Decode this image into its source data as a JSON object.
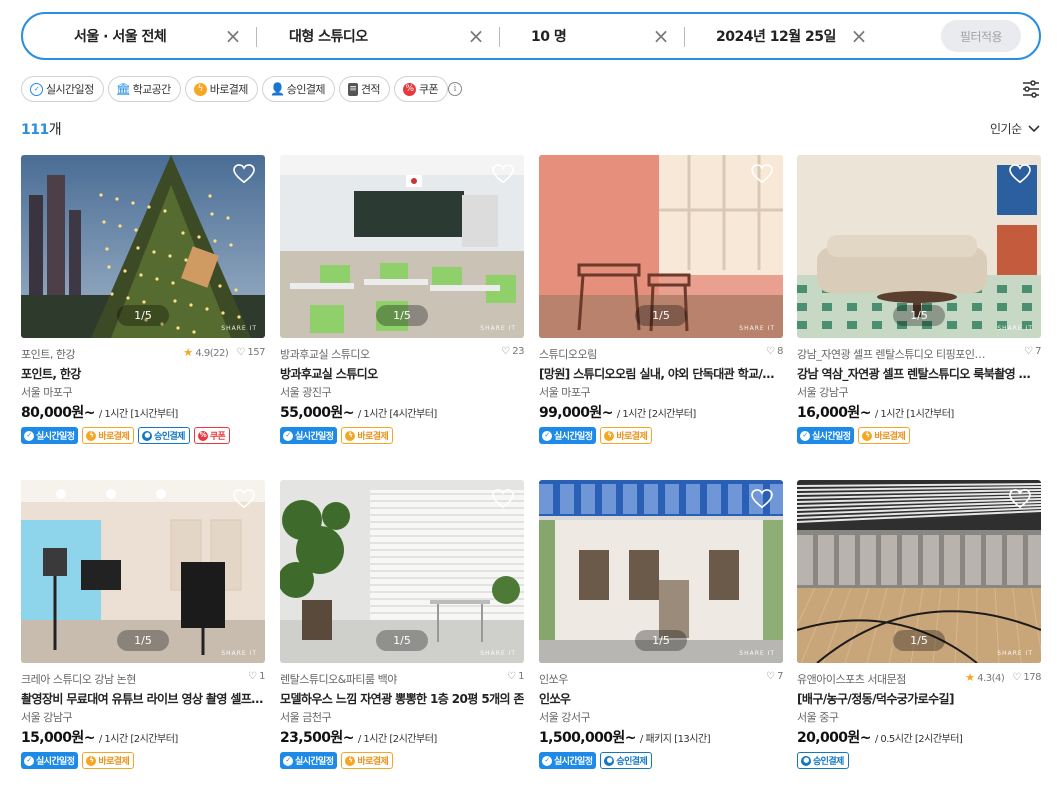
{
  "search": {
    "location": "서울 · 서울 전체",
    "space_type": "대형 스튜디오",
    "guests": "10 명",
    "date": "2024년 12월 25일",
    "apply_label": "필터적용"
  },
  "filters": [
    {
      "label": "실시간일정",
      "icon": "clock-check-icon"
    },
    {
      "label": "학교공간",
      "icon": "school-icon"
    },
    {
      "label": "바로결제",
      "icon": "lightning-icon"
    },
    {
      "label": "승인결제",
      "icon": "person-icon"
    },
    {
      "label": "견적",
      "icon": "document-icon"
    },
    {
      "label": "쿠폰",
      "icon": "coupon-icon"
    }
  ],
  "results": {
    "count": "111",
    "unit": "개",
    "sort_label": "인기순"
  },
  "colors": {
    "accent": "#2a8fe0",
    "realtime": "#1d8ae8",
    "pay": "#f5a623",
    "approve": "#1477c4",
    "coupon": "#e8383d"
  },
  "tag_labels": {
    "realtime": "실시간일정",
    "pay": "바로결제",
    "approve": "승인결제",
    "coupon": "쿠폰"
  },
  "cards": [
    {
      "pager": "1/5",
      "host": "포인트, 한강",
      "rating": "4.9(22)",
      "likes": "157",
      "title": "포인트, 한강",
      "location": "서울 마포구",
      "price": "80,000원~",
      "unit": "/ 1시간 [1시간부터]"
    },
    {
      "pager": "1/5",
      "host": "방과후교실 스튜디오",
      "rating": "",
      "likes": "23",
      "title": "방과후교실 스튜디오",
      "location": "서울 광진구",
      "price": "55,000원~",
      "unit": "/ 1시간 [4시간부터]"
    },
    {
      "pager": "1/5",
      "host": "스튜디오오림",
      "rating": "",
      "likes": "8",
      "title": "[망원] 스튜디오오림 실내, 야외 단독대관 학교/캠핑",
      "location": "서울 마포구",
      "price": "99,000원~",
      "unit": "/ 1시간 [2시간부터]"
    },
    {
      "pager": "1/5",
      "host": "강남_자연광 셀프 렌탈스튜디오 티핑포인트 남...",
      "rating": "",
      "likes": "7",
      "title": "강남 역삼_자연광 셀프 렌탈스튜디오 룩북촬영 유튜브...",
      "location": "서울 강남구",
      "price": "16,000원~",
      "unit": "/ 1시간 [1시간부터]"
    },
    {
      "pager": "1/5",
      "host": "크레아 스튜디오 강남 논현",
      "rating": "",
      "likes": "1",
      "title": "촬영장비 무료대여 유튜브 라이브 영상 촬영 셀프스튜...",
      "location": "서울 강남구",
      "price": "15,000원~",
      "unit": "/ 1시간 [2시간부터]"
    },
    {
      "pager": "1/5",
      "host": "렌탈스튜디오&파티룸 백야",
      "rating": "",
      "likes": "1",
      "title": "모델하우스 느낌 자연광 뽕뽕한 1층 20평 5개의 존",
      "location": "서울 금천구",
      "price": "23,500원~",
      "unit": "/ 1시간 [2시간부터]"
    },
    {
      "pager": "1/5",
      "host": "인쏘우",
      "rating": "",
      "likes": "7",
      "title": "인쏘우",
      "location": "서울 강서구",
      "price": "1,500,000원~",
      "unit": "/ 패키지 [13시간]"
    },
    {
      "pager": "1/5",
      "host": "유앤아이스포츠 서대문점",
      "rating": "4.3(4)",
      "likes": "178",
      "title": "[배구/농구/정동/덕수궁가로수길]",
      "location": "서울 중구",
      "price": "20,000원~",
      "unit": "/ 0.5시간 [2시간부터]"
    }
  ],
  "watermark": "SHARE IT"
}
